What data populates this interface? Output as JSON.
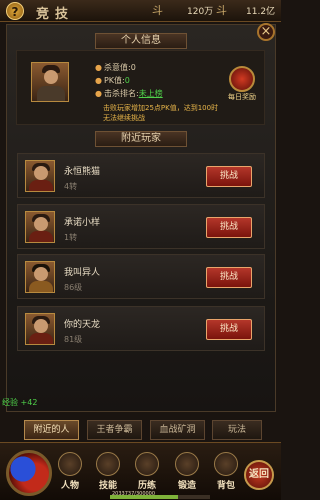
{
  "header": {
    "title": "竞技",
    "currency1_label": "斗",
    "currency1_value": "120万",
    "currency2_label": "斗",
    "currency2_value": "11.2亿"
  },
  "personal": {
    "section_title": "个人信息",
    "kill_intent_label": "杀意值:",
    "kill_intent_value": "0",
    "pk_label": "PK值:",
    "pk_value": "0",
    "rank_label": "击杀排名:",
    "rank_value": "未上榜",
    "description": "击败玩家增加25点PK值，达到100时无法继续挑战",
    "daily_reward_label": "每日奖励"
  },
  "nearby": {
    "section_title": "附近玩家",
    "challenge_label": "挑战",
    "players": [
      {
        "name": "永恒熊猫",
        "level": "4转"
      },
      {
        "name": "承诺小样",
        "level": "1转"
      },
      {
        "name": "我叫异人",
        "level": "86级"
      },
      {
        "name": "你的天龙",
        "level": "81级"
      }
    ]
  },
  "log": {
    "text": "经验 +42"
  },
  "tabs": [
    {
      "label": "附近的人",
      "active": true
    },
    {
      "label": "王者争霸",
      "active": false
    },
    {
      "label": "血战矿洞",
      "active": false
    },
    {
      "label": "玩法",
      "active": false
    }
  ],
  "menu": {
    "items": [
      "人物",
      "技能",
      "历练",
      "锻造",
      "背包"
    ],
    "return_label": "返回",
    "exp_text": "2033737/300000",
    "exp_fraction": 0.68
  },
  "help_label": "?",
  "close_label": "×"
}
